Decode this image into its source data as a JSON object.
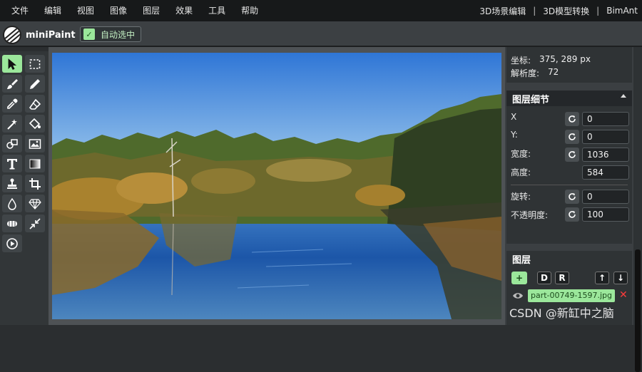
{
  "menu": {
    "items": [
      "文件",
      "编辑",
      "视图",
      "图像",
      "图层",
      "效果",
      "工具",
      "帮助"
    ],
    "right_links": [
      "3D场景编辑",
      "3D模型转换",
      "BimAnt"
    ],
    "separator": "|"
  },
  "app": {
    "name": "miniPaint"
  },
  "toolbar": {
    "auto_select_label": "自动选中",
    "auto_select_checked": true,
    "check_glyph": "✓"
  },
  "tools": [
    {
      "icon": "select-arrow-icon",
      "active": true
    },
    {
      "icon": "rect-select-icon",
      "active": false
    },
    {
      "icon": "brush-icon",
      "active": false
    },
    {
      "icon": "pencil-icon",
      "active": false
    },
    {
      "icon": "eyedropper-icon",
      "active": false
    },
    {
      "icon": "eraser-icon",
      "active": false
    },
    {
      "icon": "magic-wand-icon",
      "active": false
    },
    {
      "icon": "fill-bucket-icon",
      "active": false
    },
    {
      "icon": "shapes-icon",
      "active": false
    },
    {
      "icon": "image-icon",
      "active": false
    },
    {
      "icon": "text-icon",
      "active": false
    },
    {
      "icon": "gradient-icon",
      "active": false
    },
    {
      "icon": "clone-stamp-icon",
      "active": false
    },
    {
      "icon": "crop-icon",
      "active": false
    },
    {
      "icon": "blur-drop-icon",
      "active": false
    },
    {
      "icon": "sharpen-icon",
      "active": false
    },
    {
      "icon": "bulge-icon",
      "active": false
    },
    {
      "icon": "resize-icon",
      "active": false
    },
    {
      "icon": "play-icon",
      "active": false
    }
  ],
  "info": {
    "coords_label": "坐标:",
    "coords_value": "375, 289 px",
    "resolution_label": "解析度:",
    "resolution_value": "72"
  },
  "layer_details": {
    "title": "图层细节",
    "fields": {
      "x": {
        "label": "X",
        "value": "0"
      },
      "y": {
        "label": "Y:",
        "value": "0"
      },
      "width": {
        "label": "宽度:",
        "value": "1036"
      },
      "height": {
        "label": "高度:",
        "value": "584"
      },
      "rotate": {
        "label": "旋转:",
        "value": "0"
      },
      "opacity": {
        "label": "不透明度:",
        "value": "100"
      }
    }
  },
  "layers": {
    "title": "图层",
    "add_label": "+",
    "duplicate_label": "D",
    "raster_label": "R",
    "up_label": "↑",
    "down_label": "↓",
    "items": [
      {
        "name": "part-00749-1597.jpg",
        "visible": true
      }
    ],
    "delete_glyph": "✕"
  },
  "watermark": "CSDN @新缸中之脑",
  "colors": {
    "accent": "#9be79b",
    "delete": "#ff3b3b",
    "menubar": "#17191a",
    "panel": "#2f3335"
  }
}
